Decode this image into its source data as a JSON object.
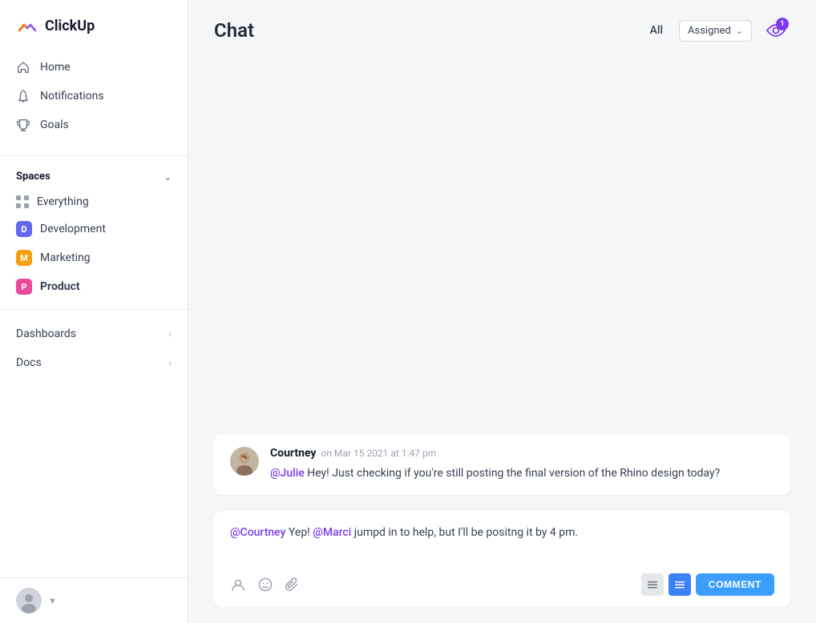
{
  "logo": {
    "text": "ClickUp"
  },
  "nav": {
    "items": [
      {
        "id": "home",
        "label": "Home",
        "icon": "home-icon"
      },
      {
        "id": "notifications",
        "label": "Notifications",
        "icon": "bell-icon"
      },
      {
        "id": "goals",
        "label": "Goals",
        "icon": "trophy-icon"
      }
    ]
  },
  "spaces": {
    "title": "Spaces",
    "items": [
      {
        "id": "everything",
        "label": "Everything",
        "type": "dots"
      },
      {
        "id": "development",
        "label": "Development",
        "type": "badge",
        "badgeColor": "#6366f1",
        "badgeLetter": "D"
      },
      {
        "id": "marketing",
        "label": "Marketing",
        "type": "badge",
        "badgeColor": "#f59e0b",
        "badgeLetter": "M"
      },
      {
        "id": "product",
        "label": "Product",
        "type": "badge",
        "badgeColor": "#ec4899",
        "badgeLetter": "P",
        "active": true
      }
    ]
  },
  "sections": [
    {
      "id": "dashboards",
      "label": "Dashboards"
    },
    {
      "id": "docs",
      "label": "Docs"
    }
  ],
  "chat": {
    "title": "Chat",
    "tabs": {
      "all": "All",
      "assigned": "Assigned"
    },
    "eye_badge_count": "1",
    "messages": [
      {
        "id": "msg1",
        "author": "Courtney",
        "time": "on Mar 15 2021 at 1:47 pm",
        "mention": "@Julie",
        "text": " Hey! Just checking if you're still posting the final version of the Rhino design today?"
      }
    ],
    "reply": {
      "mention1": "@Courtney",
      "text1": " Yep! ",
      "mention2": "@Marci",
      "text2": " jumpd in to help, but I'll be positng it by 4 pm."
    },
    "comment_btn": "COMMENT"
  }
}
